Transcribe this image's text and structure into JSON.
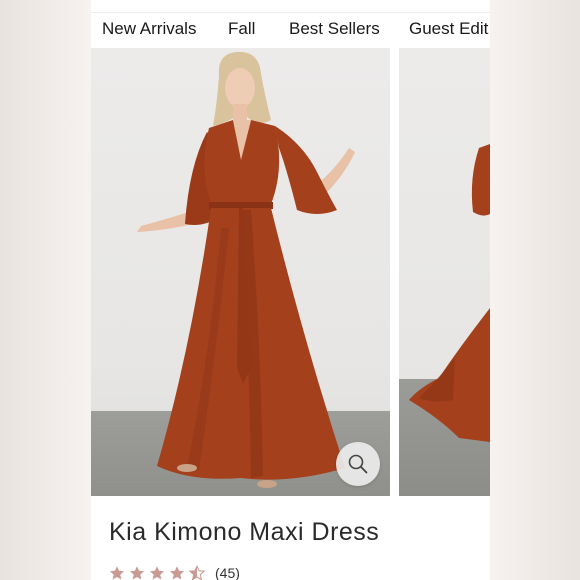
{
  "nav": {
    "items": [
      {
        "label": "New Arrivals"
      },
      {
        "label": "Fall"
      },
      {
        "label": "Best Sellers"
      },
      {
        "label": "Guest Edit"
      }
    ]
  },
  "product": {
    "title": "Kia Kimono Maxi Dress",
    "rating": 4.5,
    "review_count_text": "(45)",
    "dress_color": "#a5401d"
  },
  "icons": {
    "wishlist": "heart-icon",
    "zoom": "search-icon",
    "rating": "star-icon"
  },
  "colors": {
    "star": "#c99a93",
    "nav_text": "#1a1a1a"
  }
}
